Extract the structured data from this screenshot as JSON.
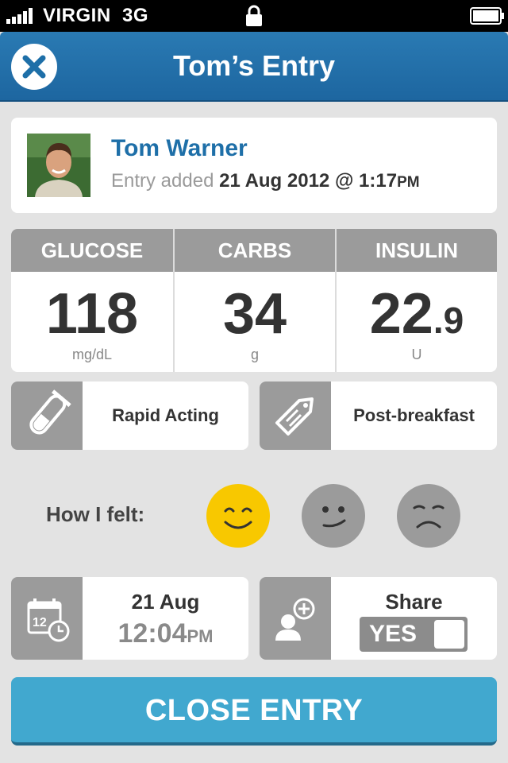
{
  "status_bar": {
    "carrier": "VIRGIN",
    "network": "3G"
  },
  "header": {
    "title": "Tom’s Entry",
    "close_icon": "close-x-icon"
  },
  "profile": {
    "name": "Tom Warner",
    "entry_prefix": "Entry added",
    "entry_date": "21 Aug 2012 @ 1:17",
    "entry_ampm": "PM"
  },
  "stats": {
    "glucose": {
      "label": "GLUCOSE",
      "value": "118",
      "unit": "mg/dL"
    },
    "carbs": {
      "label": "CARBS",
      "value": "34",
      "unit": "g"
    },
    "insulin": {
      "label": "INSULIN",
      "value_main": "22",
      "value_decimal": ".9",
      "unit": "U"
    }
  },
  "tags": {
    "insulin_type": {
      "label": "Rapid Acting",
      "icon": "test-tube-icon"
    },
    "meal_tag": {
      "label": "Post-breakfast",
      "icon": "tag-icon"
    }
  },
  "mood": {
    "label": "How I felt:",
    "options": [
      {
        "name": "happy",
        "selected": true,
        "color": "#f8c800"
      },
      {
        "name": "neutral",
        "selected": false,
        "color": "#9b9b9b"
      },
      {
        "name": "sad",
        "selected": false,
        "color": "#9b9b9b"
      }
    ]
  },
  "datetime": {
    "day": "21 Aug",
    "time": "12:04",
    "ampm": "PM",
    "icon": "calendar-clock-icon",
    "icon_number": "12"
  },
  "share": {
    "label": "Share",
    "toggle_value": "YES",
    "icon": "add-person-icon"
  },
  "footer": {
    "close_label": "CLOSE ENTRY"
  },
  "colors": {
    "header_blue": "#1e6fa8",
    "button_blue": "#41a8cf",
    "tile_grey": "#9b9b9b",
    "happy_yellow": "#f8c800"
  }
}
